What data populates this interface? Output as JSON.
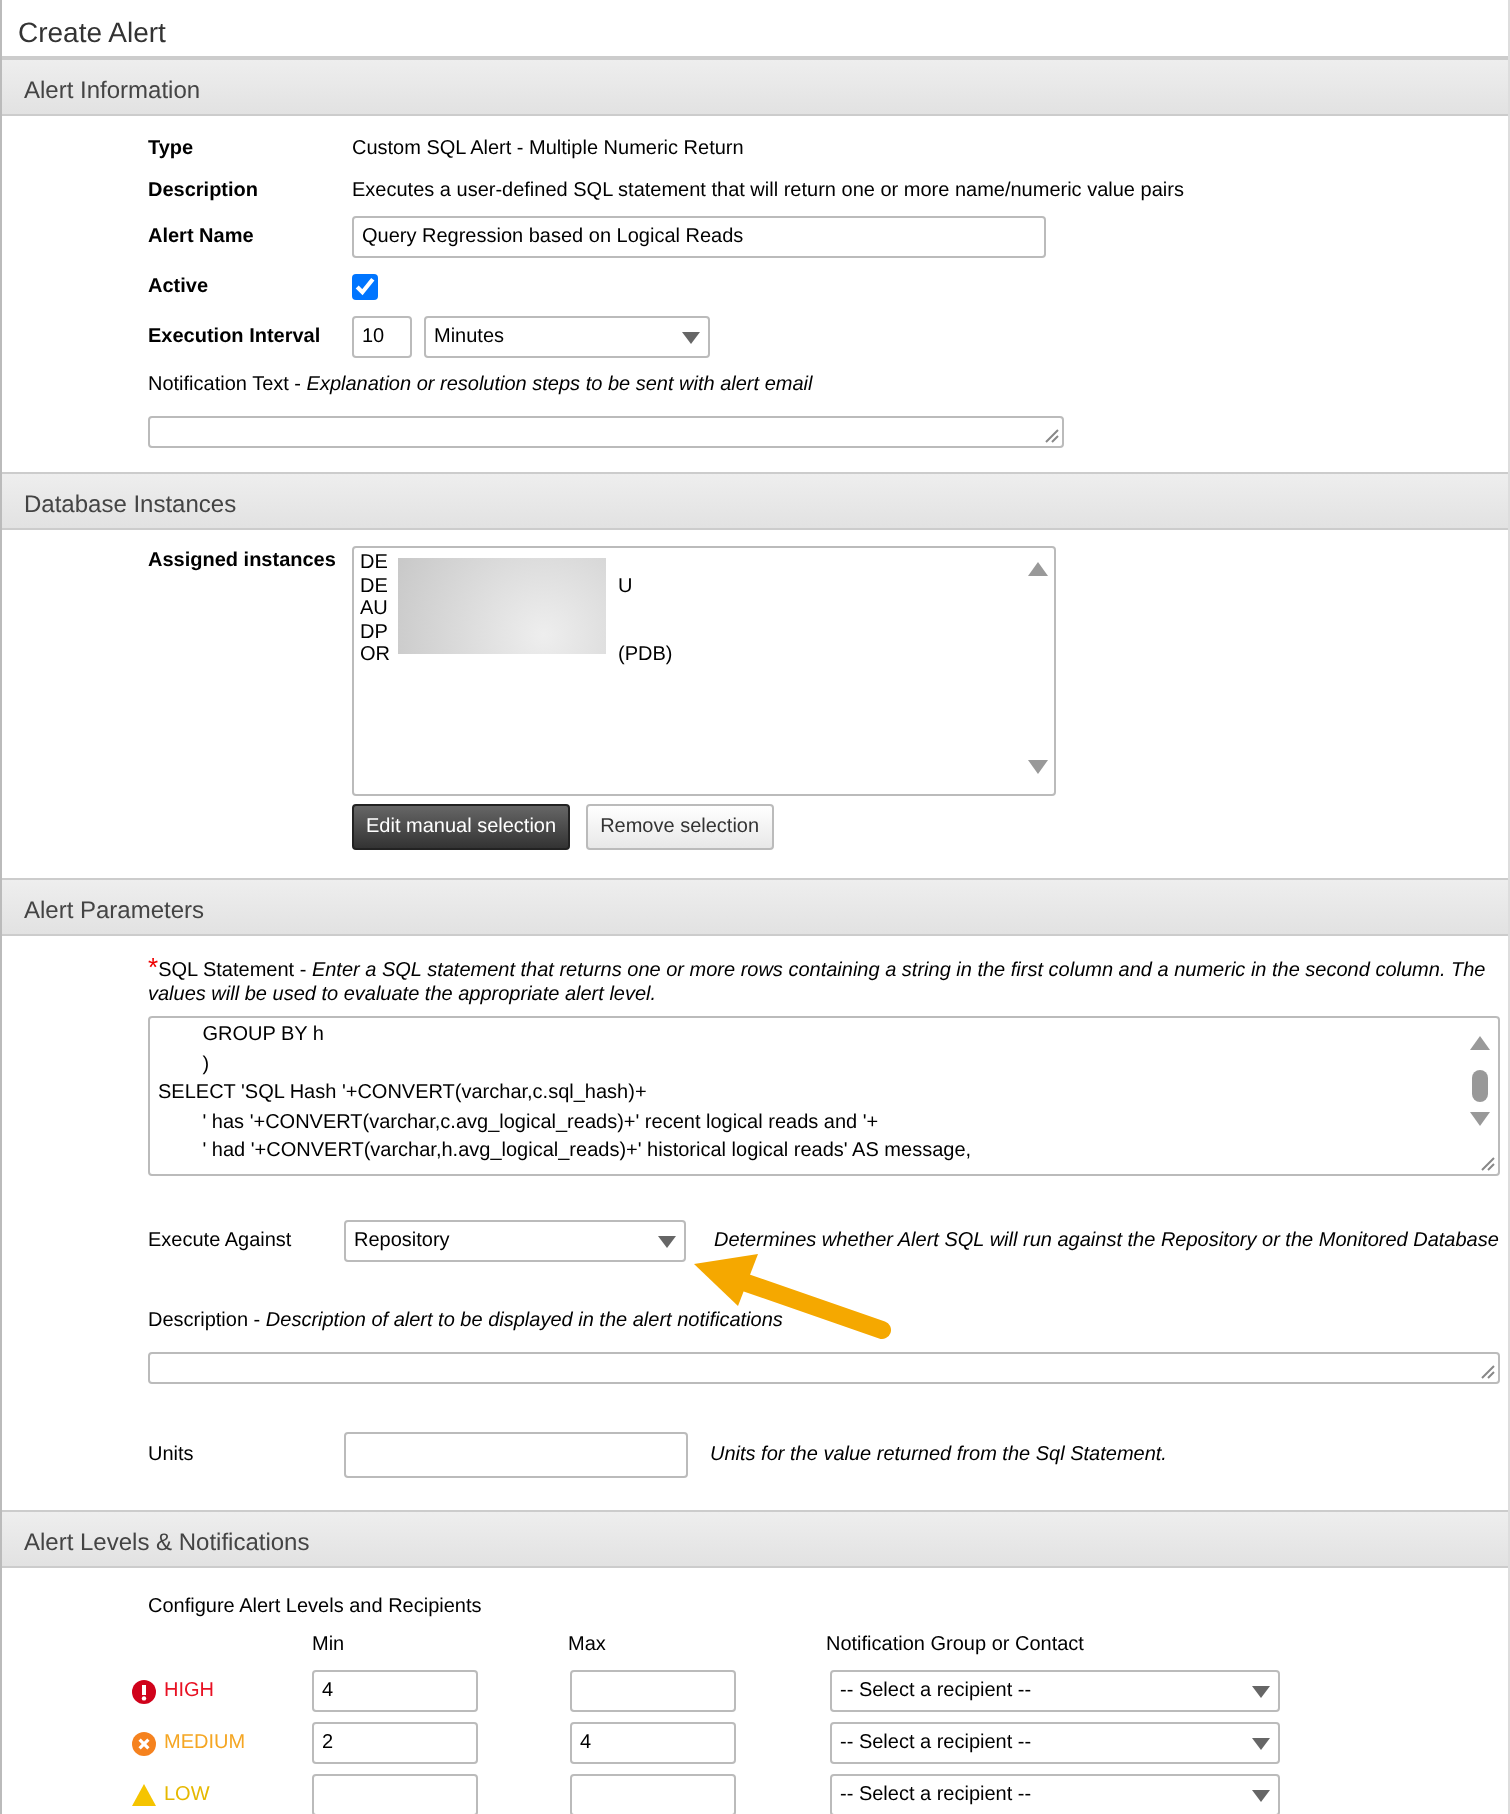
{
  "window": {
    "title": "Create Alert"
  },
  "alert_information": {
    "heading": "Alert Information",
    "fields": [
      {
        "kind": "text",
        "label": "Type",
        "value": "Custom SQL Alert - Multiple Numeric Return"
      },
      {
        "kind": "text",
        "label": "Description",
        "value": "Executes a user-defined SQL statement that will return one or more name/numeric value pairs"
      },
      {
        "kind": "input",
        "label": "Alert Name",
        "value": "Query Regression based on Logical Reads"
      },
      {
        "kind": "checkbox",
        "label": "Active",
        "checked": true
      },
      {
        "kind": "interval",
        "label": "Execution Interval",
        "value": "10",
        "unit": "Minutes"
      }
    ],
    "notification_text": {
      "label": "Notification Text -",
      "hint": "Explanation or resolution steps to be sent with alert email"
    }
  },
  "database_instances": {
    "heading": "Database Instances",
    "label": "Assigned instances",
    "instances": [
      {
        "prefix": "DE"
      },
      {
        "prefix": "DE",
        "suffix": "U"
      },
      {
        "prefix": "AU"
      },
      {
        "prefix": "DP"
      },
      {
        "prefix": "OR",
        "suffix": "(PDB)"
      }
    ],
    "buttons": [
      {
        "kind": "primary",
        "label": "Edit manual selection"
      },
      {
        "kind": "secondary",
        "label": "Remove selection"
      }
    ]
  },
  "alert_parameters": {
    "heading": "Alert Parameters",
    "sql_statement": {
      "required_mark": "*",
      "label": "SQL Statement -",
      "hint": "Enter a SQL statement that returns one or more rows containing a string in the first column and a numeric in the second column. The values will be used to evaluate the appropriate alert level.",
      "lines": [
        "        GROUP BY h",
        "        )",
        "SELECT 'SQL Hash '+CONVERT(varchar,c.sql_hash)+",
        "        ' has '+CONVERT(varchar,c.avg_logical_reads)+' recent logical reads and '+",
        "        ' had '+CONVERT(varchar,h.avg_logical_reads)+' historical logical reads' AS message,"
      ]
    },
    "execute_against": {
      "label": "Execute Against",
      "value": "Repository",
      "note": "Determines whether Alert SQL will run against the Repository or the Monitored Database"
    },
    "description": {
      "label": "Description -",
      "hint": "Description of alert to be displayed in the alert notifications"
    },
    "units": {
      "label": "Units",
      "note": "Units for the value returned from the Sql Statement."
    }
  },
  "alert_levels": {
    "heading": "Alert Levels & Notifications",
    "caption": "Configure Alert Levels and Recipients",
    "columns": [
      "Min",
      "Max",
      "Notification Group or Contact"
    ],
    "levels": [
      {
        "kind": "high",
        "label": "HIGH",
        "min": "4",
        "recipient": "-- Select a recipient --"
      },
      {
        "kind": "medium",
        "label": "MEDIUM",
        "min": "2",
        "max": "4",
        "recipient": "-- Select a recipient --"
      },
      {
        "kind": "low",
        "label": "LOW",
        "recipient": "-- Select a recipient --"
      }
    ]
  }
}
